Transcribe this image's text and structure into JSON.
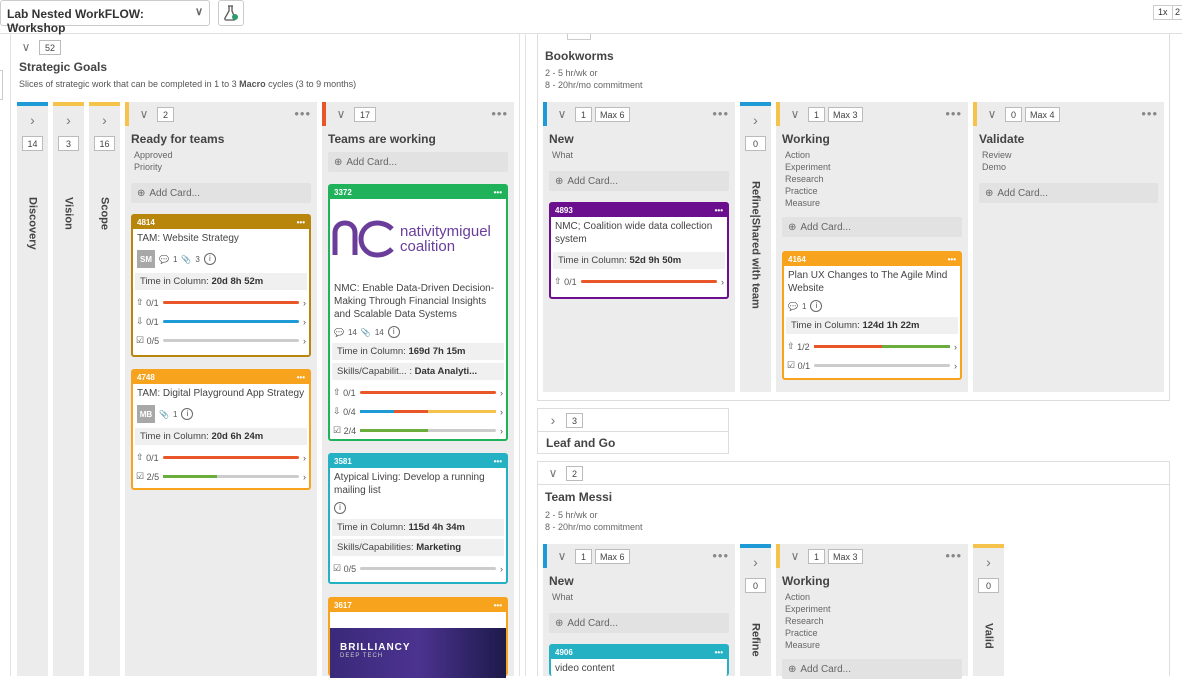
{
  "header": {
    "board_title": "Lab Nested WorkFLOW: Workshop",
    "zoom1": "1x",
    "zoom2": "2"
  },
  "left": {
    "count": "52",
    "title": "Strategic Goals",
    "desc_pre": "Slices of strategic work that can be completed in 1 to 3 ",
    "desc_bold": "Macro",
    "desc_post": " cycles (3 to 9 months)",
    "collapsed": [
      {
        "label": "Discovery",
        "count": "14",
        "color": "#1e9ad6"
      },
      {
        "label": "Vision",
        "count": "3",
        "color": "#f5c24b"
      },
      {
        "label": "Scope",
        "count": "16",
        "color": "#f5c24b"
      }
    ],
    "ready": {
      "count": "2",
      "title": "Ready for teams",
      "sub1": "Approved",
      "sub2": "Priority",
      "add": "Add Card...",
      "color": "#f5c24b"
    },
    "working": {
      "count": "17",
      "title": "Teams are working",
      "add": "Add Card...",
      "color": "#e8562a"
    }
  },
  "cards": {
    "c4814": {
      "id": "4814",
      "title": "TAM: Website Strategy",
      "avatar": "SM",
      "n1": "1",
      "n2": "3",
      "time_label": "Time in Column:",
      "time": "20d 8h 52m",
      "p1": "0/1",
      "p2": "0/1",
      "p3": "0/5"
    },
    "c4748": {
      "id": "4748",
      "title": "TAM: Digital Playground App Strategy",
      "avatar": "MB",
      "n1": "1",
      "time_label": "Time in Column:",
      "time": "20d 6h 24m",
      "p1": "0/1",
      "p2": "2/5"
    },
    "c3372": {
      "id": "3372",
      "logo1": "nativitymiguel",
      "logo2": "coalition",
      "title": "NMC: Enable Data-Driven Decision-Making Through Financial Insights and Scalable Data Systems",
      "n1": "14",
      "n2": "14",
      "time_label": "Time in Column:",
      "time": "169d 7h 15m",
      "skills_label": "Skills/Capabilit... :",
      "skills": "Data Analyti...",
      "p1": "0/1",
      "p2": "0/4",
      "p3": "2/4"
    },
    "c3581": {
      "id": "3581",
      "title": "Atypical Living: Develop a running mailing list",
      "time_label": "Time in Column:",
      "time": "115d 4h 34m",
      "skills_label": "Skills/Capabilities:",
      "skills": "Marketing",
      "p1": "0/5"
    },
    "c3617": {
      "id": "3617",
      "img_title": "BRILLIANCY",
      "img_sub": "DEEP TECH"
    },
    "c4893": {
      "id": "4893",
      "title": "NMC; Coalition wide data collection system",
      "time_label": "Time in Column:",
      "time": "52d 9h 50m",
      "p1": "0/1"
    },
    "c4164": {
      "id": "4164",
      "title": "Plan UX Changes to The Agile Mind Website",
      "n1": "1",
      "time_label": "Time in Column:",
      "time": "124d 1h 22m",
      "p1": "1/2",
      "p2": "0/1"
    },
    "c4906": {
      "id": "4906",
      "title": "video content"
    }
  },
  "bookworms": {
    "title": "Bookworms",
    "sub1": "2 - 5 hr/wk or",
    "sub2": "8 - 20hr/mo commitment",
    "new": {
      "count": "1",
      "max": "Max 6",
      "title": "New",
      "sub": "What",
      "add": "Add Card..."
    },
    "refine": {
      "count": "0",
      "label": "Refine|Shared with team"
    },
    "working": {
      "count": "1",
      "max": "Max 3",
      "title": "Working",
      "subs": [
        "Action",
        "Experiment",
        "Research",
        "Practice",
        "Measure"
      ],
      "add": "Add Card..."
    },
    "validate": {
      "count": "0",
      "max": "Max 4",
      "title": "Validate",
      "sub1": "Review",
      "sub2": "Demo",
      "add": "Add Card..."
    }
  },
  "leaf": {
    "count": "3",
    "title": "Leaf and Go"
  },
  "messi": {
    "count": "2",
    "title": "Team Messi",
    "sub1": "2 - 5 hr/wk or",
    "sub2": "8 - 20hr/mo commitment",
    "new": {
      "count": "1",
      "max": "Max 6",
      "title": "New",
      "sub": "What",
      "add": "Add Card..."
    },
    "refine": {
      "count": "0",
      "label": "Refine"
    },
    "working": {
      "count": "1",
      "max": "Max 3",
      "title": "Working",
      "subs": [
        "Action",
        "Experiment",
        "Research",
        "Practice",
        "Measure"
      ],
      "add": "Add Card..."
    },
    "validate": {
      "count": "0",
      "label": "Valid"
    }
  }
}
